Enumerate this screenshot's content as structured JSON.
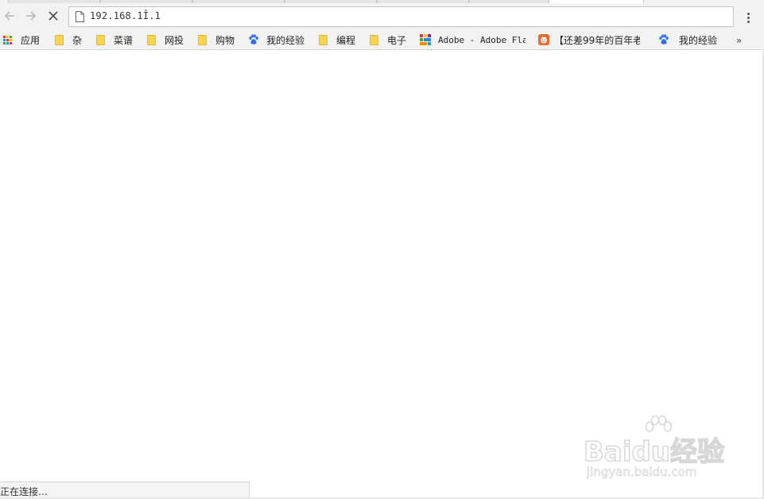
{
  "colors": {
    "chrome_bg": "#f2f2f2",
    "folder_yellow": "#fbd44f",
    "baidu_blue": "#2f6ff0",
    "orange_icon": "#f0672a"
  },
  "toolbar": {
    "back_icon": "arrow-left-icon",
    "forward_icon": "arrow-right-icon",
    "stop_icon": "close-icon",
    "url": "192.168.1.1",
    "url_display": "192.168.1Ī.1",
    "menu_icon": "vertical-ellipsis-icon"
  },
  "bookmarks": {
    "items": [
      {
        "label": "应用",
        "icon": "apps-grid-icon"
      },
      {
        "label": "杂",
        "icon": "folder-icon"
      },
      {
        "label": "菜谱",
        "icon": "folder-icon"
      },
      {
        "label": "网投",
        "icon": "folder-icon"
      },
      {
        "label": "购物",
        "icon": "folder-icon"
      },
      {
        "label": "我的经验",
        "icon": "baidu-paw-icon"
      },
      {
        "label": "编程",
        "icon": "folder-icon"
      },
      {
        "label": "电子",
        "icon": "folder-icon"
      },
      {
        "label": "Adobe - Adobe Flas",
        "icon": "adobe-colorful-icon"
      },
      {
        "label": "【还差99年的百年老",
        "icon": "orange-face-icon"
      },
      {
        "label": "我的经验",
        "icon": "baidu-paw-icon"
      }
    ],
    "more_label": "»"
  },
  "status": {
    "text": "正在连接…"
  },
  "watermark": {
    "logo": "Baidu经验",
    "url": "jingyan.baidu.com"
  }
}
